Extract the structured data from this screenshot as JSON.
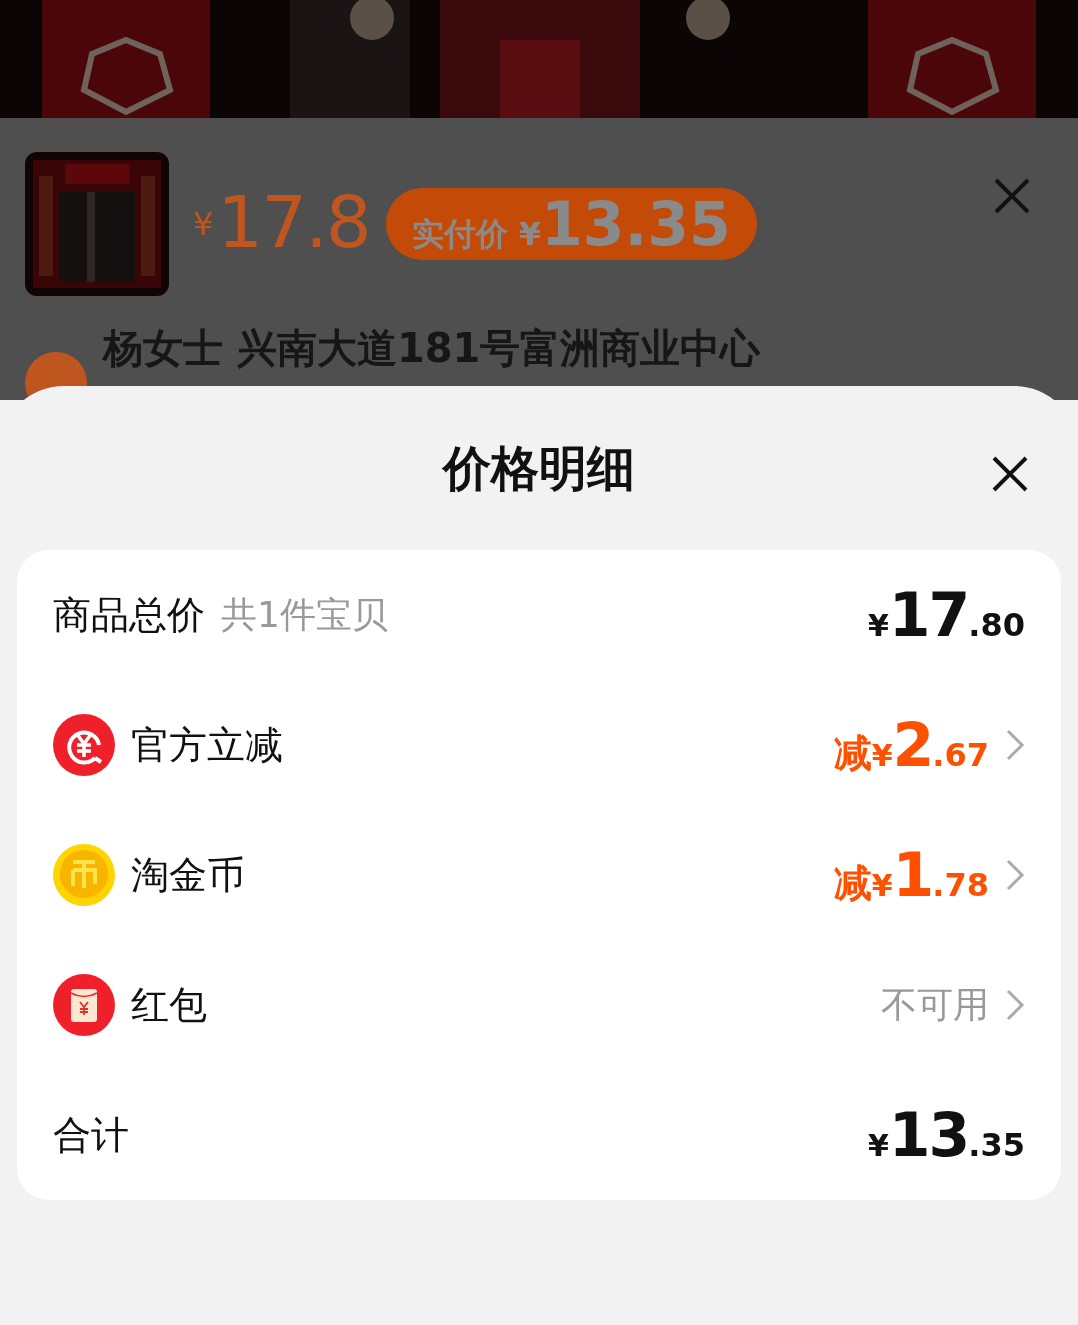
{
  "product": {
    "price_currency": "¥",
    "price": "17.8",
    "actual_price_label": "实付价",
    "actual_price_currency": "¥",
    "actual_price": "13.35"
  },
  "address": {
    "text": "杨女士 兴南大道181号富洲商业中心"
  },
  "sheet": {
    "title": "价格明细",
    "rows": [
      {
        "kind": "total",
        "label": "商品总价",
        "note": "共1件宝贝",
        "currency": "¥",
        "integer": "17",
        "decimal": ".80"
      },
      {
        "kind": "discount",
        "label": "官方立减",
        "prefix": "减",
        "currency": "¥",
        "integer": "2",
        "decimal": ".67"
      },
      {
        "kind": "discount",
        "label": "淘金币",
        "prefix": "减",
        "currency": "¥",
        "integer": "1",
        "decimal": ".78"
      },
      {
        "kind": "unavailable",
        "label": "红包",
        "value": "不可用"
      },
      {
        "kind": "sum",
        "label": "合计",
        "currency": "¥",
        "integer": "13",
        "decimal": ".35"
      }
    ]
  }
}
